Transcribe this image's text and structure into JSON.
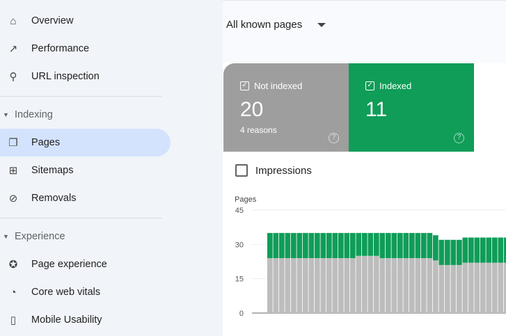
{
  "sidebar": {
    "items_top": [
      {
        "label": "Overview",
        "icon": "home-icon"
      },
      {
        "label": "Performance",
        "icon": "trending-icon"
      },
      {
        "label": "URL inspection",
        "icon": "search-icon"
      }
    ],
    "indexing": {
      "label": "Indexing",
      "items": [
        {
          "label": "Pages",
          "icon": "pages-icon",
          "active": true
        },
        {
          "label": "Sitemaps",
          "icon": "sitemap-icon"
        },
        {
          "label": "Removals",
          "icon": "eye-off-icon"
        }
      ]
    },
    "experience": {
      "label": "Experience",
      "items": [
        {
          "label": "Page experience",
          "icon": "star-badge-icon"
        },
        {
          "label": "Core web vitals",
          "icon": "gauge-icon"
        },
        {
          "label": "Mobile Usability",
          "icon": "phone-icon"
        }
      ]
    }
  },
  "filter": {
    "label": "All known pages"
  },
  "cards": {
    "not_indexed": {
      "label": "Not indexed",
      "value": "20",
      "sub": "4 reasons",
      "color": "#9e9e9e"
    },
    "indexed": {
      "label": "Indexed",
      "value": "11",
      "color": "#0f9d58"
    }
  },
  "impressions": {
    "label": "Impressions",
    "checked": false
  },
  "chart_data": {
    "type": "bar",
    "stacked": true,
    "ylabel": "Pages",
    "ylim": [
      0,
      45
    ],
    "yticks": [
      "45",
      "30",
      "15",
      "0"
    ],
    "series": [
      {
        "name": "Not indexed",
        "color": "#bdbdbd",
        "values": [
          24,
          24,
          24,
          24,
          24,
          24,
          24,
          24,
          24,
          24,
          24,
          24,
          24,
          24,
          24,
          25,
          25,
          25,
          25,
          24,
          24,
          24,
          24,
          24,
          24,
          24,
          24,
          24,
          23,
          21,
          21,
          21,
          21,
          22,
          22,
          22,
          22,
          22,
          22,
          22,
          22
        ]
      },
      {
        "name": "Indexed",
        "color": "#0f9d58",
        "values": [
          11,
          11,
          11,
          11,
          11,
          11,
          11,
          11,
          11,
          11,
          11,
          11,
          11,
          11,
          11,
          10,
          10,
          10,
          10,
          11,
          11,
          11,
          11,
          11,
          11,
          11,
          11,
          11,
          11,
          11,
          11,
          11,
          11,
          11,
          11,
          11,
          11,
          11,
          11,
          11,
          11
        ]
      }
    ]
  }
}
